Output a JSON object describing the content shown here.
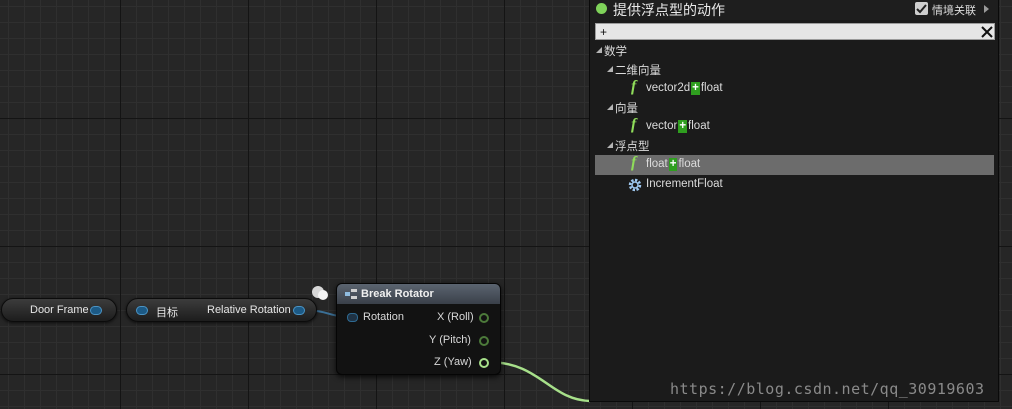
{
  "nodes": {
    "door_frame": {
      "label": "Door Frame"
    },
    "target": {
      "label": "目标",
      "output": "Relative Rotation"
    },
    "break_rotator": {
      "title": "Break Rotator",
      "input": "Rotation",
      "outputs": [
        "X (Roll)",
        "Y (Pitch)",
        "Z (Yaw)"
      ]
    }
  },
  "action_menu": {
    "title": "提供浮点型的动作",
    "context_label": "情境关联",
    "context_checked": true,
    "search": {
      "value": "+"
    },
    "tree": {
      "math": "数学",
      "vector2d": "二维向量",
      "vector2d_item": {
        "pre": "vector2d",
        "op": "+",
        "post": "float"
      },
      "vector": "向量",
      "vector_item": {
        "pre": "vector",
        "op": "+",
        "post": "float"
      },
      "float": "浮点型",
      "float_item": {
        "pre": "float",
        "op": "+",
        "post": "float"
      },
      "increment": "IncrementFloat"
    }
  },
  "watermark": "https://blog.csdn.net/qq_30919603",
  "colors": {
    "float_pin": "#a7e08a",
    "rotator_pin": "#4a93c4",
    "header": "#4a515b",
    "selection": "#6c6c6c",
    "plus_highlight": "#2f9e1f"
  }
}
